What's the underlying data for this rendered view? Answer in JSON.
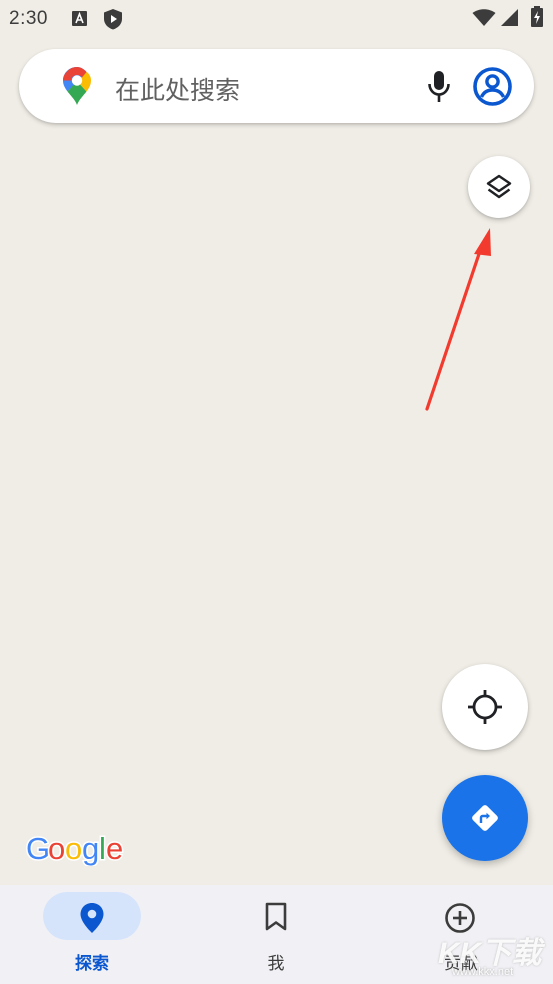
{
  "status_bar": {
    "time": "2:30"
  },
  "search": {
    "placeholder": "在此处搜索"
  },
  "map": {
    "attribution": "Google"
  },
  "bottom_nav": {
    "items": [
      {
        "label": "探索",
        "icon": "location-pin-icon",
        "active": true
      },
      {
        "label": "我",
        "icon": "bookmark-icon",
        "active": false
      },
      {
        "label": "贡献",
        "icon": "add-circle-icon",
        "active": false
      }
    ]
  },
  "watermark": {
    "main": "KK下载",
    "url": "www.kkx.net"
  },
  "colors": {
    "map_background": "#f0ede6",
    "accent_blue": "#1a73e8",
    "nav_active": "#0b57d0",
    "annotation_arrow": "#f23b2e"
  }
}
